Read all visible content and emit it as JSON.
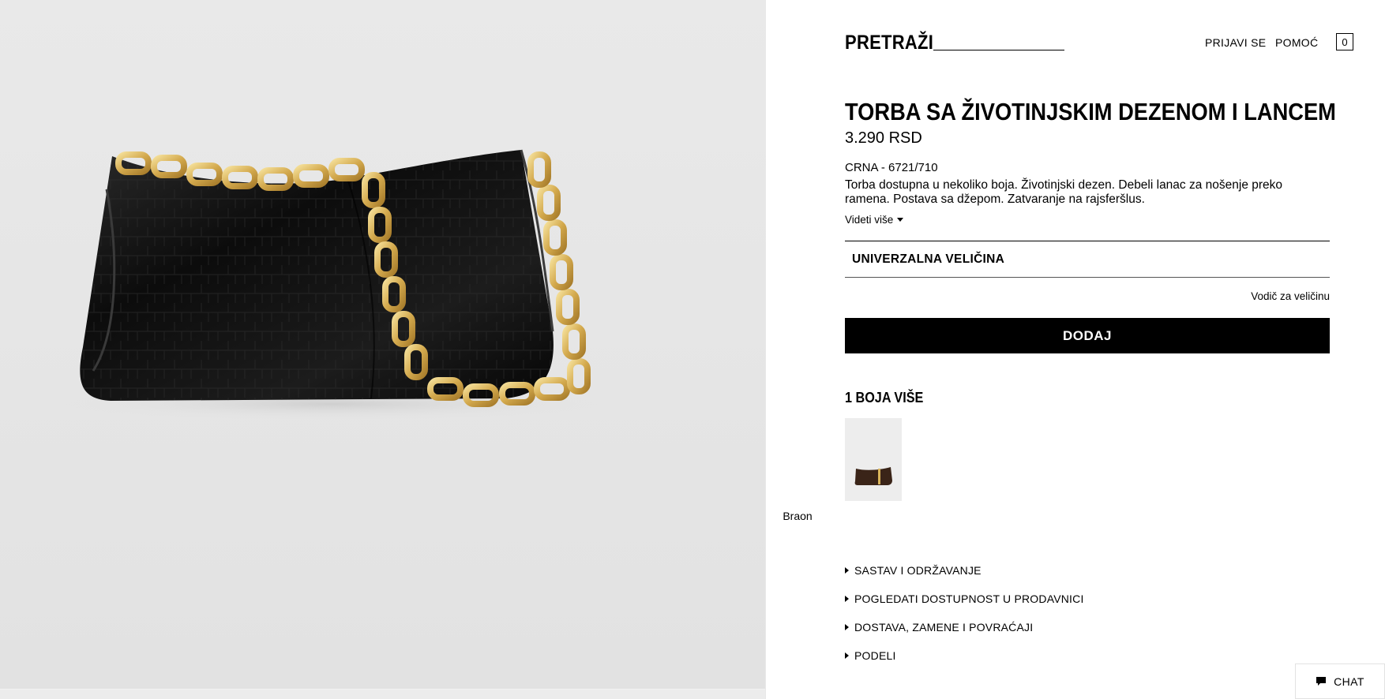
{
  "header": {
    "search_label": "PRETRAŽI",
    "login_label": "PRIJAVI SE",
    "help_label": "POMOĆ",
    "cart_count": "0"
  },
  "product": {
    "title": "TORBA SA ŽIVOTINJSKIM DEZENOM I LANCEM",
    "price": "3.290 RSD",
    "color_code": "CRNA - 6721/710",
    "description": "Torba dostupna u nekoliko boja. Životinjski dezen. Debeli lanac za nošenje preko ramena. Postava sa džepom. Zatvaranje na rajsferšlus.",
    "see_more": "Videti više",
    "image_icon": "black-croc-bag-with-gold-chain"
  },
  "size": {
    "selected": "UNIVERZALNA VELIČINA",
    "guide_label": "Vodič za veličinu"
  },
  "cart_button": {
    "label": "DODAJ"
  },
  "colors": {
    "heading": "1 BOJA VIŠE",
    "items": [
      {
        "label": "Braon",
        "swatch_color": "#3a2418"
      }
    ]
  },
  "accordion": [
    {
      "label": "SASTAV I ODRŽAVANJE"
    },
    {
      "label": "POGLEDATI DOSTUPNOST U PRODAVNICI"
    },
    {
      "label": "DOSTAVA, ZAMENE I POVRAĆAJI"
    },
    {
      "label": "PODELI"
    }
  ],
  "chat": {
    "label": "CHAT"
  },
  "theme": {
    "image_bg": "#e6e6e6",
    "button_bg": "#000000",
    "chain_gold": "#d9b45a",
    "leather_black": "#111111"
  }
}
